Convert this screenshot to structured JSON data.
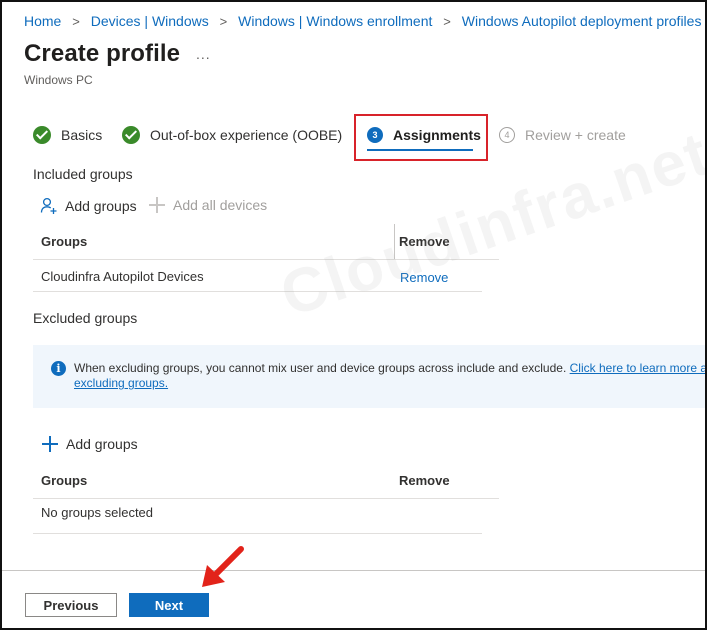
{
  "breadcrumb": {
    "items": [
      "Home",
      "Devices | Windows",
      "Windows | Windows enrollment",
      "Windows Autopilot deployment profiles"
    ],
    "separator": ">"
  },
  "header": {
    "title": "Create profile",
    "more": "...",
    "subtitle": "Windows PC"
  },
  "steps": [
    {
      "label": "Basics",
      "state": "complete"
    },
    {
      "label": "Out-of-box experience (OOBE)",
      "state": "complete"
    },
    {
      "number": "3",
      "label": "Assignments",
      "state": "current"
    },
    {
      "number": "4",
      "label": "Review + create",
      "state": "disabled"
    }
  ],
  "included": {
    "section_label": "Included groups",
    "add_groups": "Add groups",
    "add_all_devices": "Add all devices",
    "columns": [
      "Groups",
      "Remove"
    ],
    "rows": [
      {
        "group": "Cloudinfra Autopilot Devices",
        "remove": "Remove"
      }
    ]
  },
  "excluded": {
    "section_label": "Excluded groups",
    "info_text": "When excluding groups, you cannot mix user and device groups across include and exclude.",
    "info_link_part1": "Click here to learn more ab",
    "info_link_part2": "excluding groups.",
    "add_groups": "Add groups",
    "columns": [
      "Groups",
      "Remove"
    ],
    "empty_text": "No groups selected"
  },
  "footer": {
    "previous": "Previous",
    "next": "Next"
  },
  "watermark": "Cloudinfra.net",
  "colors": {
    "accent": "#0f6cbd",
    "success": "#3a8a2a",
    "highlight": "#d8232a",
    "info_background": "#f0f6fc"
  },
  "icons": {
    "step_complete": "check-circle-icon",
    "info": "info-icon",
    "add": "plus-icon",
    "add_user": "add-person-icon",
    "annotation": "red-arrow-icon"
  }
}
